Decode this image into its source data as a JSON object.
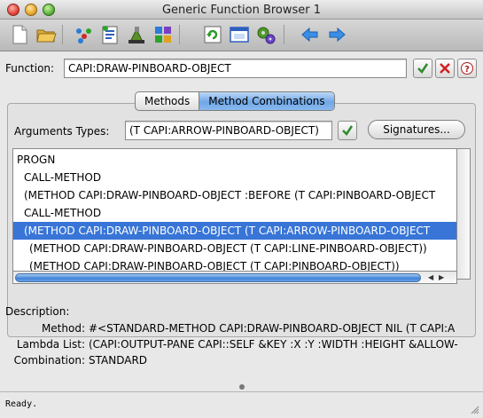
{
  "window": {
    "title": "Generic Function Browser 1"
  },
  "toolbar": {
    "buttons": [
      {
        "name": "new-document-icon"
      },
      {
        "name": "open-folder-icon"
      },
      {
        "name": "inspect-icon"
      },
      {
        "name": "listing-icon"
      },
      {
        "name": "tools-icon"
      },
      {
        "name": "components-icon"
      },
      {
        "name": "refresh-icon"
      },
      {
        "name": "window-icon"
      },
      {
        "name": "gears-icon"
      },
      {
        "name": "back-arrow-icon"
      },
      {
        "name": "forward-arrow-icon"
      }
    ]
  },
  "function_field": {
    "label": "Function:",
    "value": "CAPI:DRAW-PINBOARD-OBJECT"
  },
  "tabs": [
    {
      "label": "Methods",
      "active": false
    },
    {
      "label": "Method Combinations",
      "active": true
    }
  ],
  "arguments": {
    "label": "Arguments Types:",
    "value": "(T CAPI:ARROW-PINBOARD-OBJECT)",
    "signatures_label": "Signatures..."
  },
  "combination_list": {
    "rows": [
      {
        "text": "PROGN",
        "indent": 0,
        "selected": false
      },
      {
        "text": "CALL-METHOD",
        "indent": 1,
        "selected": false
      },
      {
        "text": "(METHOD CAPI:DRAW-PINBOARD-OBJECT :BEFORE (T CAPI:PINBOARD-OBJECT",
        "indent": 1,
        "selected": false
      },
      {
        "text": "CALL-METHOD",
        "indent": 1,
        "selected": false
      },
      {
        "text": "(METHOD CAPI:DRAW-PINBOARD-OBJECT (T CAPI:ARROW-PINBOARD-OBJECT",
        "indent": 1,
        "selected": true
      },
      {
        "text": "(METHOD CAPI:DRAW-PINBOARD-OBJECT (T CAPI:LINE-PINBOARD-OBJECT))",
        "indent": 2,
        "selected": false
      },
      {
        "text": "(METHOD CAPI:DRAW-PINBOARD-OBJECT (T CAPI:PINBOARD-OBJECT))",
        "indent": 2,
        "selected": false
      }
    ]
  },
  "description": {
    "label": "Description:",
    "rows": [
      {
        "label": "Method:",
        "value": "#<STANDARD-METHOD CAPI:DRAW-PINBOARD-OBJECT NIL (T CAPI:A"
      },
      {
        "label": "Lambda List:",
        "value": "(CAPI:OUTPUT-PANE CAPI::SELF &KEY :X :Y :WIDTH :HEIGHT &ALLOW-"
      },
      {
        "label": "Combination:",
        "value": "STANDARD"
      }
    ]
  },
  "status": {
    "text": "Ready."
  },
  "colors": {
    "selection": "#3875d7",
    "check_green": "#2e8b2e",
    "cross_red": "#d02020",
    "arrow_blue": "#3a8ee6"
  }
}
